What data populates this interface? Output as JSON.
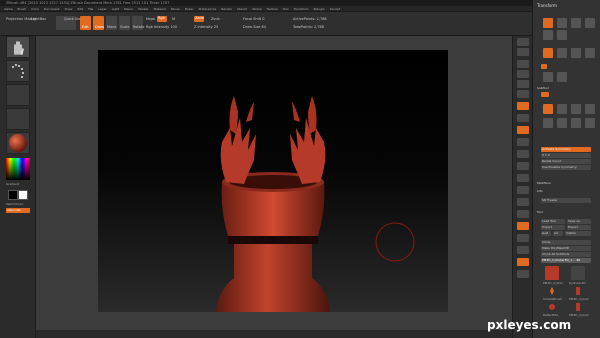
{
  "titlebar": {
    "title": "ZBrush 4R4 [2010 1013 1327 1534]   ZBrush Document   Mem 1761 Free 2511 101 Timer 1707",
    "quick_save": "QuickSave",
    "default_layout": "DefaultZScript"
  },
  "menubar": {
    "items": [
      "Alpha",
      "Brush",
      "Color",
      "Document",
      "Draw",
      "Edit",
      "File",
      "Layer",
      "Light",
      "Macro",
      "Marker",
      "Material",
      "Movie",
      "Picker",
      "Preferences",
      "Render",
      "Stencil",
      "Stroke",
      "Texture",
      "Tool",
      "Transform",
      "Zplugin",
      "Zscript"
    ]
  },
  "topbar": {
    "projection_master": "Projection Master",
    "lightbox": "LightBox",
    "quick_sketch": "Quick Sketch",
    "edit": "Edit",
    "draw": "Draw",
    "move": "Move",
    "scale": "Scale",
    "rotate": "Rotate",
    "mrgb": "Mrgb",
    "rgb": "Rgb",
    "m": "M",
    "rgb_intensity": "Rgb Intensity 100",
    "zadd": "Zadd",
    "zsub": "Zsub",
    "z_intensity": "Z Intensity 25",
    "focal_shift": "Focal Shift 0",
    "draw_size": "Draw Size 64",
    "active_points": "ActivePoints: 2,786",
    "total_points": "TotalPoints: 2,786"
  },
  "left_shelf": {
    "gradient_label": "Gradient",
    "switch_color_label": "SwitchColor",
    "alternate_label": "Alternate"
  },
  "palette": {
    "header": "Transform",
    "lightbox_tools": "Lightbox ▸ Tools",
    "tool_name": "Polymesh3D_1",
    "dynamic_subdiv": "Dynamic Subdiv",
    "qgrid": "QGrid",
    "subtool": "SubTool",
    "visible_symmetry": "Activate Symmetry",
    "xyz": "X  Y  Z",
    "radial_count": "Radial Count",
    "use_posable_symmetry": "Use Posable Symmetry",
    "modifiers": "Modifiers",
    "info": "Info",
    "sd_freeze": "SD Freeze",
    "tool_section": "Tool",
    "load_tool": "Load Tool",
    "save_as": "Save As",
    "import": "Import",
    "export": "Export",
    "goz": "GoZ",
    "all": "All",
    "visible": "Visible",
    "make_polymesh": "Make PolyMesh3D",
    "clone": "Clone",
    "all_subtools": "Clone All SubTools",
    "current_tool": "PM3D_Cylinder3D_1 -- 48",
    "thumb_labels": [
      "PM3D_Cylind",
      "Cylinder3D",
      "SimpleBrush",
      "PM3D_Cylind",
      "ReflectMA",
      "PM3D_Cylind"
    ]
  },
  "colors": {
    "accent": "#e06a1f",
    "model": "#b53a2a"
  },
  "watermark": "pxleyes.com"
}
